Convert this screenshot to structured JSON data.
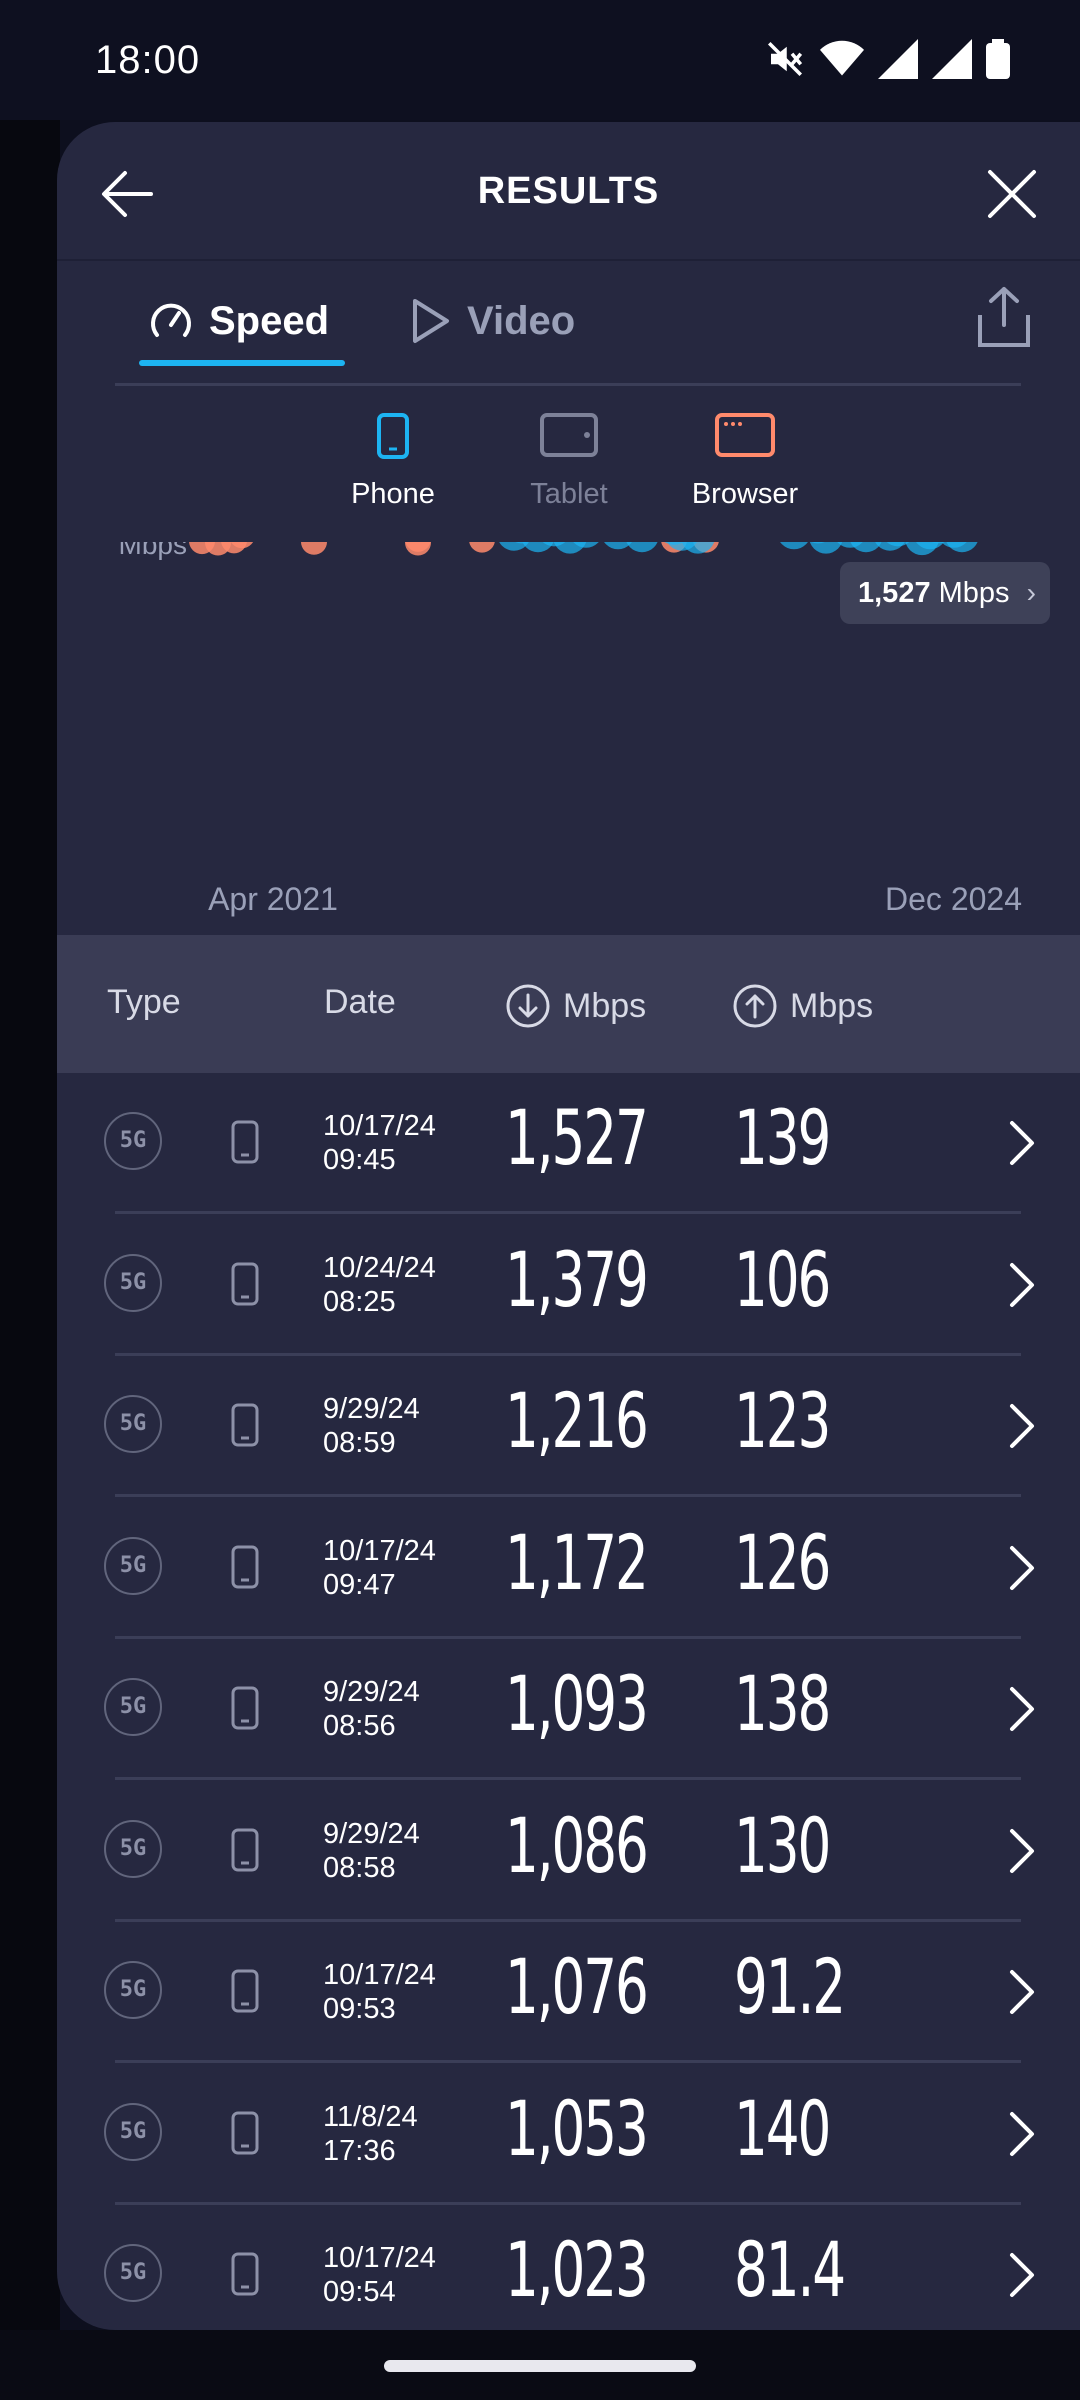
{
  "status_bar": {
    "time": "18:00"
  },
  "header": {
    "title": "RESULTS"
  },
  "tabs": [
    {
      "label": "Speed",
      "active": true
    },
    {
      "label": "Video",
      "active": false
    }
  ],
  "devices": [
    {
      "label": "Phone",
      "selected": true
    },
    {
      "label": "Tablet",
      "selected": false
    },
    {
      "label": "Browser",
      "selected": true
    }
  ],
  "tooltip": {
    "value": "1,527",
    "unit": "Mbps"
  },
  "colors": {
    "accent": "#1db4f2",
    "browser": "#ff8a6c",
    "sheet": "#262840"
  },
  "chart_data": {
    "type": "scatter",
    "yunit_label": "Mbps",
    "y_ticks": [
      1600,
      1280,
      960,
      640,
      320
    ],
    "ylim": [
      0,
      1600
    ],
    "x_start_label": "Apr 2021",
    "x_end_label": "Dec 2024",
    "series": [
      {
        "name": "Browser",
        "color": "#ff8a6c",
        "points": [
          [
            0.0,
            20
          ],
          [
            0.02,
            10
          ],
          [
            0.04,
            25
          ],
          [
            0.05,
            230
          ],
          [
            0.05,
            370
          ],
          [
            0.05,
            480
          ],
          [
            0.05,
            60
          ],
          [
            0.14,
            15
          ],
          [
            0.27,
            10
          ],
          [
            0.27,
            35
          ],
          [
            0.35,
            30
          ],
          [
            0.46,
            120
          ],
          [
            0.49,
            260
          ],
          [
            0.57,
            110
          ],
          [
            0.59,
            30
          ],
          [
            0.63,
            30
          ]
        ]
      },
      {
        "name": "Phone",
        "color": "#1db4f2",
        "points": [
          [
            0.39,
            70
          ],
          [
            0.4,
            120
          ],
          [
            0.42,
            60
          ],
          [
            0.44,
            100
          ],
          [
            0.45,
            150
          ],
          [
            0.46,
            50
          ],
          [
            0.47,
            180
          ],
          [
            0.48,
            90
          ],
          [
            0.49,
            210
          ],
          [
            0.5,
            130
          ],
          [
            0.51,
            250
          ],
          [
            0.52,
            80
          ],
          [
            0.53,
            170
          ],
          [
            0.54,
            230
          ],
          [
            0.54,
            380
          ],
          [
            0.55,
            60
          ],
          [
            0.56,
            140
          ],
          [
            0.58,
            200
          ],
          [
            0.59,
            110
          ],
          [
            0.6,
            70
          ],
          [
            0.62,
            50
          ],
          [
            0.74,
            80
          ],
          [
            0.75,
            190
          ],
          [
            0.76,
            260
          ],
          [
            0.77,
            120
          ],
          [
            0.78,
            50
          ],
          [
            0.79,
            220
          ],
          [
            0.8,
            150
          ],
          [
            0.81,
            90
          ],
          [
            0.82,
            180
          ],
          [
            0.83,
            60
          ],
          [
            0.84,
            140
          ],
          [
            0.85,
            200
          ],
          [
            0.86,
            70
          ],
          [
            0.87,
            100
          ],
          [
            0.9,
            40
          ],
          [
            0.91,
            80
          ],
          [
            0.92,
            120
          ],
          [
            0.93,
            170
          ],
          [
            0.94,
            90
          ],
          [
            0.95,
            60
          ],
          [
            0.96,
            240
          ],
          [
            0.97,
            150
          ],
          [
            0.97,
            420
          ],
          [
            0.98,
            600
          ],
          [
            0.98,
            300
          ],
          [
            0.99,
            500
          ],
          [
            0.99,
            180
          ],
          [
            1.0,
            700
          ],
          [
            1.0,
            380
          ],
          [
            0.99,
            850
          ],
          [
            1.0,
            1000
          ],
          [
            1.01,
            1100
          ],
          [
            1.0,
            1380
          ],
          [
            1.01,
            1200
          ],
          [
            1.01,
            1527
          ],
          [
            1.02,
            900
          ],
          [
            1.02,
            620
          ],
          [
            1.03,
            450
          ],
          [
            1.03,
            260
          ],
          [
            1.04,
            780
          ],
          [
            1.04,
            540
          ],
          [
            1.05,
            330
          ],
          [
            1.05,
            680
          ],
          [
            1.06,
            420
          ],
          [
            1.07,
            200
          ]
        ]
      }
    ]
  },
  "table": {
    "columns": {
      "type": "Type",
      "date": "Date",
      "download": "Mbps",
      "upload": "Mbps"
    },
    "rows": [
      {
        "network": "5G",
        "date": "10/17/24",
        "time": "09:45",
        "download": "1,527",
        "upload": "139"
      },
      {
        "network": "5G",
        "date": "10/24/24",
        "time": "08:25",
        "download": "1,379",
        "upload": "106"
      },
      {
        "network": "5G",
        "date": "9/29/24",
        "time": "08:59",
        "download": "1,216",
        "upload": "123"
      },
      {
        "network": "5G",
        "date": "10/17/24",
        "time": "09:47",
        "download": "1,172",
        "upload": "126"
      },
      {
        "network": "5G",
        "date": "9/29/24",
        "time": "08:56",
        "download": "1,093",
        "upload": "138"
      },
      {
        "network": "5G",
        "date": "9/29/24",
        "time": "08:58",
        "download": "1,086",
        "upload": "130"
      },
      {
        "network": "5G",
        "date": "10/17/24",
        "time": "09:53",
        "download": "1,076",
        "upload": "91.2"
      },
      {
        "network": "5G",
        "date": "11/8/24",
        "time": "17:36",
        "download": "1,053",
        "upload": "140"
      },
      {
        "network": "5G",
        "date": "10/17/24",
        "time": "09:54",
        "download": "1,023",
        "upload": "81.4"
      }
    ]
  }
}
